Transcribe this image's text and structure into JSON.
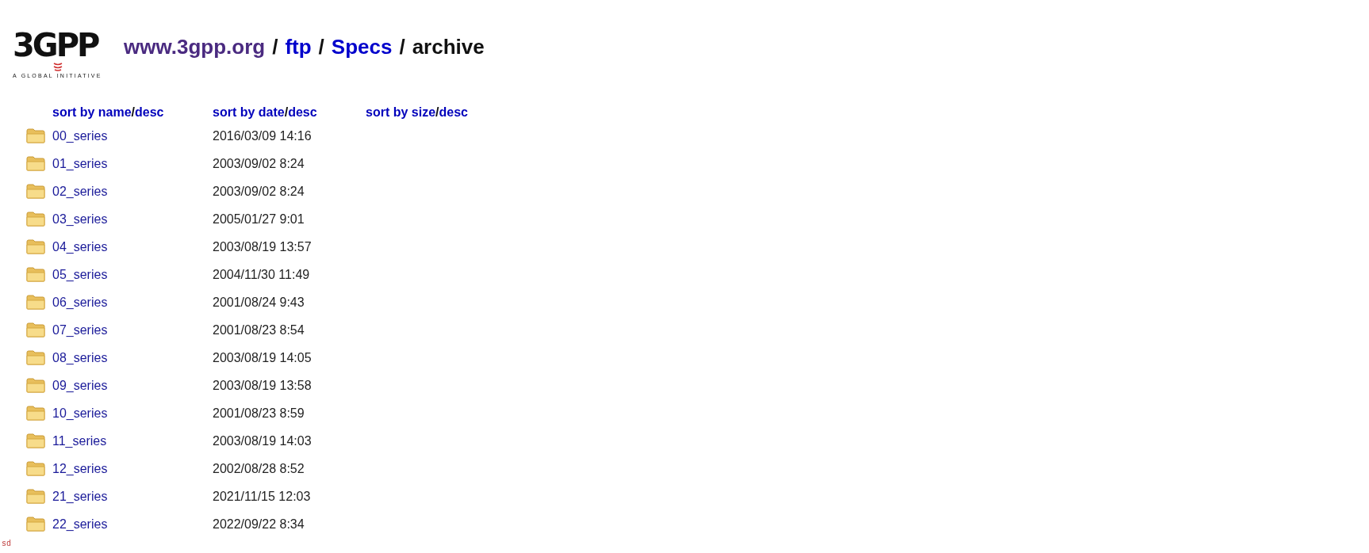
{
  "logo": {
    "wordmark": "3GPP",
    "tagline": "A GLOBAL INITIATIVE"
  },
  "breadcrumb": {
    "separator": "/",
    "segments": [
      {
        "label": "www.3gpp.org",
        "kind": "visited"
      },
      {
        "label": "ftp",
        "kind": "link"
      },
      {
        "label": "Specs",
        "kind": "link"
      },
      {
        "label": "archive",
        "kind": "current"
      }
    ]
  },
  "sort_links": {
    "separator": "/",
    "columns": [
      {
        "label": "sort by name",
        "order": "desc"
      },
      {
        "label": "sort by date",
        "order": "desc"
      },
      {
        "label": "sort by size",
        "order": "desc"
      }
    ]
  },
  "entries": [
    {
      "name": "00_series",
      "date": "2016/03/09 14:16"
    },
    {
      "name": "01_series",
      "date": "2003/09/02 8:24"
    },
    {
      "name": "02_series",
      "date": "2003/09/02 8:24"
    },
    {
      "name": "03_series",
      "date": "2005/01/27 9:01"
    },
    {
      "name": "04_series",
      "date": "2003/08/19 13:57"
    },
    {
      "name": "05_series",
      "date": "2004/11/30 11:49"
    },
    {
      "name": "06_series",
      "date": "2001/08/24 9:43"
    },
    {
      "name": "07_series",
      "date": "2001/08/23 8:54"
    },
    {
      "name": "08_series",
      "date": "2003/08/19 14:05"
    },
    {
      "name": "09_series",
      "date": "2003/08/19 13:58"
    },
    {
      "name": "10_series",
      "date": "2001/08/23 8:59"
    },
    {
      "name": "11_series",
      "date": "2003/08/19 14:03"
    },
    {
      "name": "12_series",
      "date": "2002/08/28 8:52"
    },
    {
      "name": "21_series",
      "date": "2021/11/15 12:03"
    },
    {
      "name": "22_series",
      "date": "2022/09/22 8:34"
    }
  ],
  "footer_note": "sd"
}
